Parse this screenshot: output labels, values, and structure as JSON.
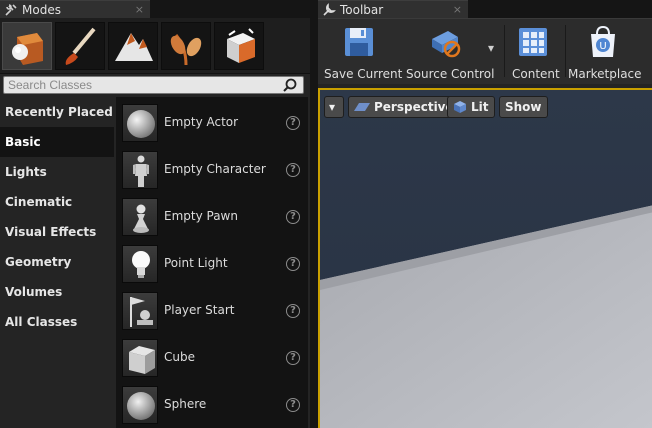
{
  "modes_tab": {
    "title": "Modes",
    "close": "×"
  },
  "toolbar_tab": {
    "title": "Toolbar",
    "close": "×"
  },
  "modes": [
    "place-mode",
    "paint-mode",
    "landscape-mode",
    "foliage-mode",
    "geometry-mode"
  ],
  "search": {
    "placeholder": "Search Classes",
    "value": ""
  },
  "categories": [
    {
      "label": "Recently Placed"
    },
    {
      "label": "Basic",
      "active": true
    },
    {
      "label": "Lights"
    },
    {
      "label": "Cinematic"
    },
    {
      "label": "Visual Effects"
    },
    {
      "label": "Geometry"
    },
    {
      "label": "Volumes"
    },
    {
      "label": "All Classes"
    }
  ],
  "classes": [
    {
      "label": "Empty Actor",
      "icon": "sphere-actor-icon"
    },
    {
      "label": "Empty Character",
      "icon": "character-icon"
    },
    {
      "label": "Empty Pawn",
      "icon": "pawn-icon"
    },
    {
      "label": "Point Light",
      "icon": "light-bulb-icon"
    },
    {
      "label": "Player Start",
      "icon": "player-start-icon"
    },
    {
      "label": "Cube",
      "icon": "cube-icon"
    },
    {
      "label": "Sphere",
      "icon": "sphere-icon"
    }
  ],
  "help_glyph": "?",
  "toolbar": {
    "save_current": "Save Current",
    "source_control": "Source Control",
    "content": "Content",
    "marketplace": "Marketplace",
    "dropdown_glyph": "▾"
  },
  "viewport": {
    "menu_glyph": "▾",
    "perspective": "Perspective",
    "lit": "Lit",
    "show": "Show"
  },
  "colors": {
    "accent_border": "#c9a000",
    "sky": "#2a3545",
    "floor": "#b4b6bc"
  }
}
